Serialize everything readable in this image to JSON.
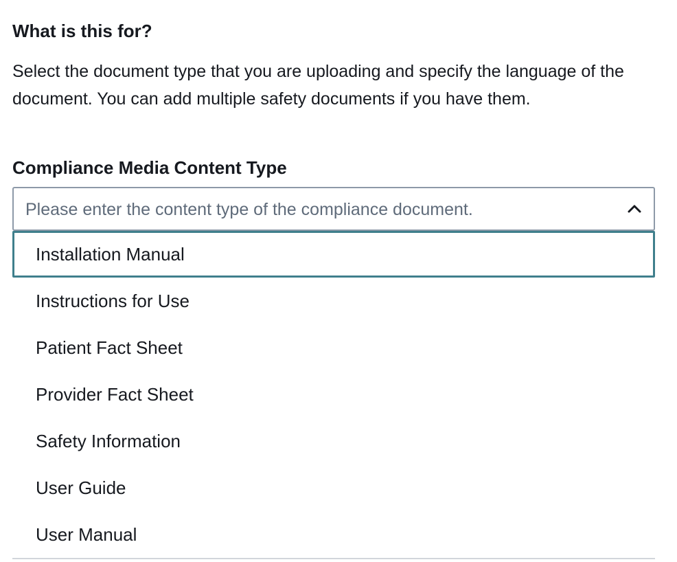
{
  "section": {
    "heading": "What is this for?",
    "description": "Select the document type that you are uploading and specify the language of the document. You can add multiple safety documents if you have them."
  },
  "field": {
    "label": "Compliance Media Content Type",
    "placeholder": "Please enter the content type of the compliance document.",
    "expanded_icon": "chevron-up-icon"
  },
  "dropdown": {
    "highlighted_index": 0,
    "options": [
      {
        "label": "Installation Manual"
      },
      {
        "label": "Instructions for Use"
      },
      {
        "label": "Patient Fact Sheet"
      },
      {
        "label": "Provider Fact Sheet"
      },
      {
        "label": "Safety Information"
      },
      {
        "label": "User Guide"
      },
      {
        "label": "User Manual"
      }
    ]
  },
  "colors": {
    "text": "#16191f",
    "placeholder": "#5f6b7a",
    "input_border": "#8d99a8",
    "highlight_border": "#3f7f8c"
  }
}
